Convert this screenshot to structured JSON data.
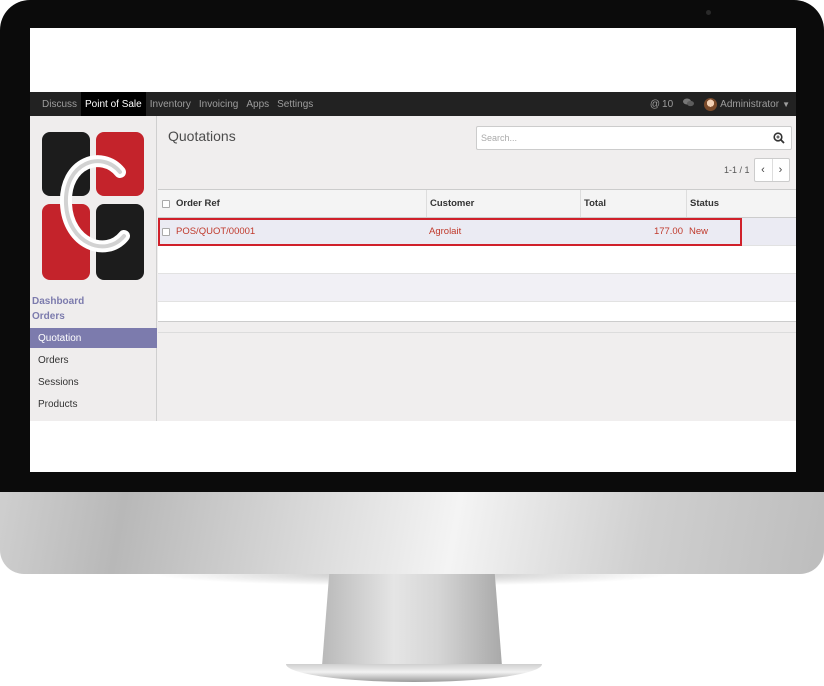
{
  "topbar": {
    "nav": [
      "Discuss",
      "Point of Sale",
      "Inventory",
      "Invoicing",
      "Apps",
      "Settings"
    ],
    "active": "Point of Sale",
    "messages_count": "10",
    "user": "Administrator"
  },
  "sidebar": {
    "headers": [
      "Dashboard",
      "Orders"
    ],
    "items": [
      "Quotation",
      "Orders",
      "Sessions",
      "Products"
    ],
    "active_item": "Quotation",
    "accent": "#7c7bad"
  },
  "main": {
    "title": "Quotations",
    "search_placeholder": "Search...",
    "pager": "1-1 / 1",
    "columns": [
      "Order Ref",
      "Customer",
      "Total",
      "Status"
    ],
    "rows": [
      {
        "order_ref": "POS/QUOT/00001",
        "customer": "Agrolait",
        "total": "177.00",
        "status": "New"
      }
    ]
  },
  "colors": {
    "topbar_bg": "#222222",
    "row_text": "#c0392b",
    "highlight": "#d0202a"
  }
}
